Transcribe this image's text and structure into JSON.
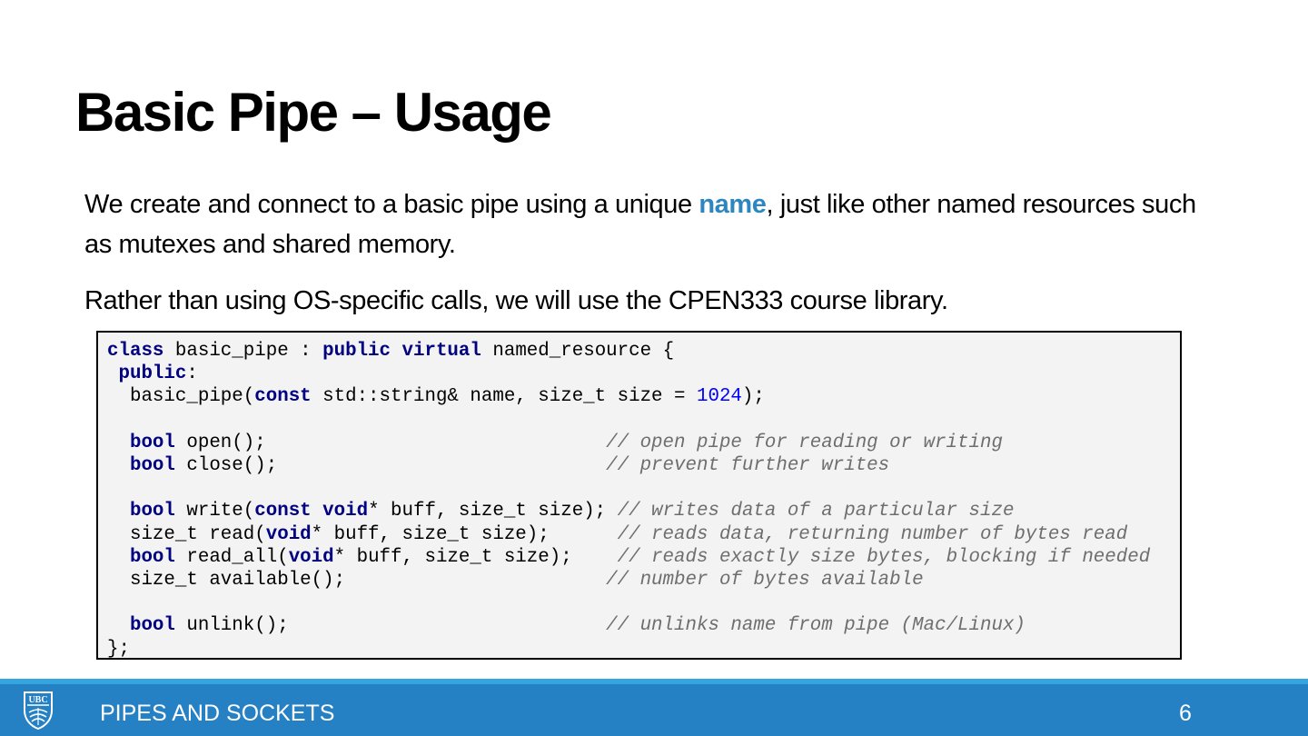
{
  "slide": {
    "title": "Basic Pipe – Usage",
    "paragraph1": {
      "before": "We create and connect to a basic pipe using a unique ",
      "highlight": "name",
      "after": ", just like other named resources such as mutexes and shared memory."
    },
    "paragraph2": "Rather than using OS-specific calls, we will use the CPEN333 course library.",
    "code_lines": [
      [
        {
          "t": "class",
          "c": "kw"
        },
        {
          "t": " basic_pipe : "
        },
        {
          "t": "public",
          "c": "kw"
        },
        {
          "t": " "
        },
        {
          "t": "virtual",
          "c": "kw"
        },
        {
          "t": " named_resource {"
        }
      ],
      [
        {
          "t": " "
        },
        {
          "t": "public",
          "c": "kw"
        },
        {
          "t": ":"
        }
      ],
      [
        {
          "t": "  basic_pipe("
        },
        {
          "t": "const",
          "c": "kw"
        },
        {
          "t": " std::string& name, size_t size = "
        },
        {
          "t": "1024",
          "c": "num"
        },
        {
          "t": ");"
        }
      ],
      [
        {
          "t": ""
        }
      ],
      [
        {
          "t": "  "
        },
        {
          "t": "bool",
          "c": "kw"
        },
        {
          "t": " open();                              "
        },
        {
          "t": "// open pipe for reading or writing",
          "c": "cm"
        }
      ],
      [
        {
          "t": "  "
        },
        {
          "t": "bool",
          "c": "kw"
        },
        {
          "t": " close();                             "
        },
        {
          "t": "// prevent further writes",
          "c": "cm"
        }
      ],
      [
        {
          "t": ""
        }
      ],
      [
        {
          "t": "  "
        },
        {
          "t": "bool",
          "c": "kw"
        },
        {
          "t": " write("
        },
        {
          "t": "const",
          "c": "kw"
        },
        {
          "t": " "
        },
        {
          "t": "void",
          "c": "kw"
        },
        {
          "t": "* buff, size_t size); "
        },
        {
          "t": "// writes data of a particular size",
          "c": "cm"
        }
      ],
      [
        {
          "t": "  size_t read("
        },
        {
          "t": "void",
          "c": "kw"
        },
        {
          "t": "* buff, size_t size);      "
        },
        {
          "t": "// reads data, returning number of bytes read",
          "c": "cm"
        }
      ],
      [
        {
          "t": "  "
        },
        {
          "t": "bool",
          "c": "kw"
        },
        {
          "t": " read_all("
        },
        {
          "t": "void",
          "c": "kw"
        },
        {
          "t": "* buff, size_t size);    "
        },
        {
          "t": "// reads exactly size bytes, blocking if needed",
          "c": "cm"
        }
      ],
      [
        {
          "t": "  size_t available();                       "
        },
        {
          "t": "// number of bytes available",
          "c": "cm"
        }
      ],
      [
        {
          "t": ""
        }
      ],
      [
        {
          "t": "  "
        },
        {
          "t": "bool",
          "c": "kw"
        },
        {
          "t": " unlink();                            "
        },
        {
          "t": "// unlinks name from pipe (Mac/Linux)",
          "c": "cm"
        }
      ],
      [
        {
          "t": "};"
        }
      ]
    ]
  },
  "footer": {
    "logo_text": "UBC",
    "logo_icon": "ubc-crest-icon",
    "title": "PIPES AND SOCKETS",
    "page_number": "6"
  },
  "colors": {
    "highlight": "#2e86c1",
    "keyword": "#000080",
    "number": "#0000ff",
    "comment": "#6e6e6e",
    "code_background": "#f3f3f3",
    "footer": "#2581c4",
    "footer_stripe": "#35a5dd"
  }
}
